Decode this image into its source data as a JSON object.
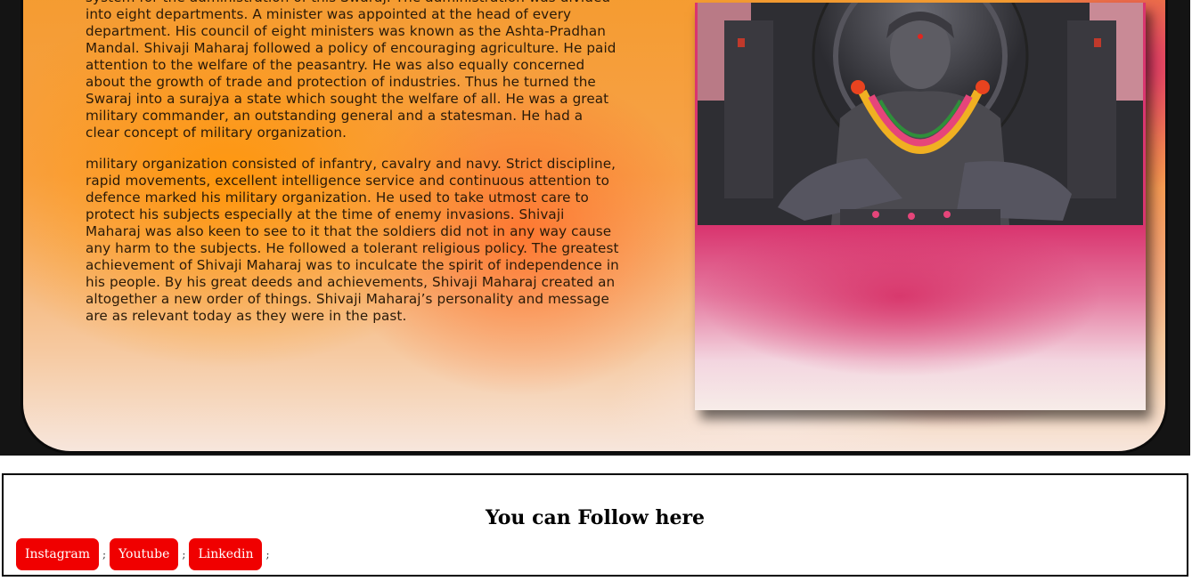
{
  "article": {
    "paragraph1": "Raigad and Thane districts of Maharashtra. It also included parts of Belgaum, Karwar and Dharwad districts of Karnataka and Jinjee, Vellore and their neighbouring areas in state of Tamil Nadu. He set up an efficient and sound system for the administration of this Swaraj. The administration was divided into eight departments. A minister was appointed at the head of every department. His council of eight ministers was known as the Ashta-Pradhan Mandal. Shivaji Maharaj followed a policy of encouraging agriculture. He paid attention to the welfare of the peasantry. He was also equally concerned about the growth of trade and protection of industries. Thus he turned the Swaraj into a surajya a state which sought the welfare of all. He was a great military commander, an outstanding general and a statesman. He had a clear concept of military organization.",
    "paragraph2": "military organization consisted of infantry, cavalry and navy. Strict discipline, rapid movements, excellent intelligence service and continuous attention to defence marked his military organization. He used to take utmost care to protect his subjects especially at the time of enemy invasions. Shivaji Maharaj was also keen to see to it that the soldiers did not in any way cause any harm to the subjects. He followed a tolerant religious policy. The greatest achievement of Shivaji Maharaj was to inculcate the spirit of independence in his people. By his great deeds and achievements, Shivaji Maharaj created an altogether a new order of things. Shivaji Maharaj’s personality and message are as relevant today as they were in the past."
  },
  "follow": {
    "heading": "You can Follow here",
    "links": [
      "Instagram",
      "Youtube",
      "Linkedin"
    ],
    "separator": ";",
    "button_color": "#f00000"
  }
}
